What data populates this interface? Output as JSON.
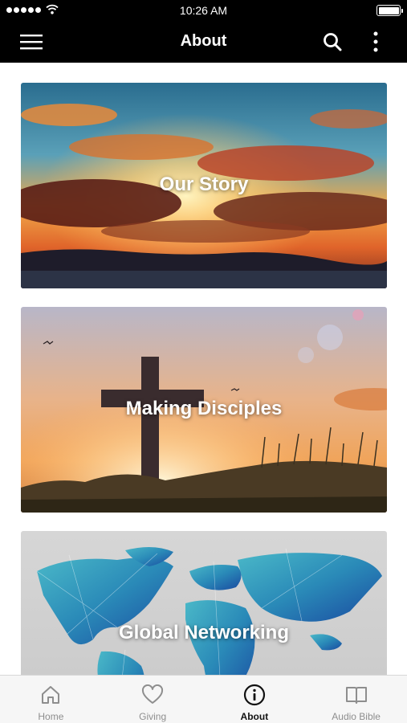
{
  "status_bar": {
    "time": "10:26 AM"
  },
  "header": {
    "title": "About"
  },
  "cards": [
    {
      "title": "Our Story"
    },
    {
      "title": "Making Disciples"
    },
    {
      "title": "Global Networking"
    }
  ],
  "tabs": [
    {
      "label": "Home",
      "icon": "home-icon",
      "active": false
    },
    {
      "label": "Giving",
      "icon": "heart-icon",
      "active": false
    },
    {
      "label": "About",
      "icon": "info-icon",
      "active": true
    },
    {
      "label": "Audio Bible",
      "icon": "book-icon",
      "active": false
    }
  ],
  "colors": {
    "bar_background": "#000000",
    "tab_bar_background": "#f6f6f6",
    "active_tab": "#111111",
    "inactive_tab": "#8e8e8e"
  }
}
